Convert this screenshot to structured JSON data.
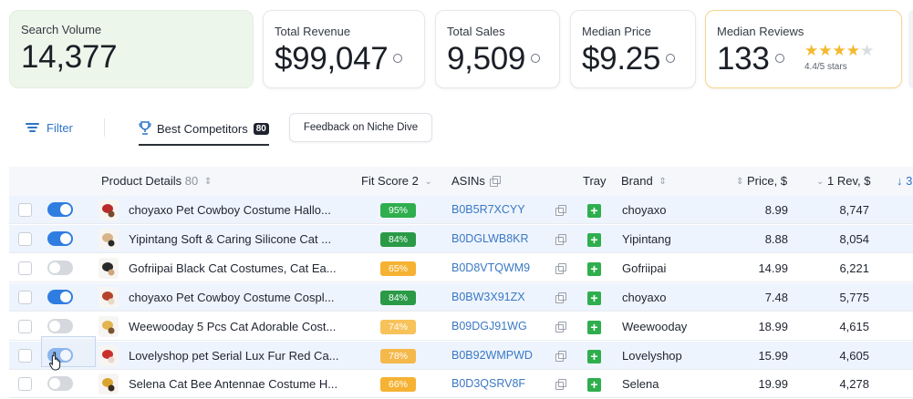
{
  "metrics": {
    "search_volume": {
      "label": "Search Volume",
      "value": "14,377"
    },
    "total_revenue": {
      "label": "Total Revenue",
      "value": "$99,047"
    },
    "total_sales": {
      "label": "Total Sales",
      "value": "9,509"
    },
    "median_price": {
      "label": "Median Price",
      "value": "$9.25"
    },
    "median_reviews": {
      "label": "Median Reviews",
      "value": "133",
      "rating_note": "4.4/5 stars",
      "rating": 4.4,
      "stars_max": 5
    }
  },
  "toolbar": {
    "filter_label": "Filter",
    "best_competitors_label": "Best Competitors",
    "best_competitors_count": "80",
    "feedback_label": "Feedback on Niche Dive"
  },
  "table": {
    "columns": {
      "product_details": "Product Details",
      "product_count": "80",
      "fit_score": "Fit Score",
      "fit_score_num": "2",
      "asins": "ASINs",
      "tray": "Tray",
      "brand": "Brand",
      "price": "Price, $",
      "rev_num": "1",
      "rev": "Rev, $",
      "next_col": "3"
    },
    "rows": [
      {
        "toggle": true,
        "product": "choyaxo Pet Cowboy Costume Hallo...",
        "fit": "95%",
        "fit_color": "#2fae4e",
        "asin": "B0B5R7XCYY",
        "brand": "choyaxo",
        "price": "8.99",
        "rev": "8,747",
        "selected": true
      },
      {
        "toggle": true,
        "product": "Yipintang Soft & Caring Silicone Cat ...",
        "fit": "84%",
        "fit_color": "#2a9a47",
        "asin": "B0DGLWB8KR",
        "brand": "Yipintang",
        "price": "8.88",
        "rev": "8,054",
        "selected": true
      },
      {
        "toggle": false,
        "product": "Gofriipai Black Cat Costumes, Cat Ea...",
        "fit": "65%",
        "fit_color": "#f6b233",
        "asin": "B0D8VTQWM9",
        "brand": "Gofriipai",
        "price": "14.99",
        "rev": "6,221",
        "selected": false
      },
      {
        "toggle": true,
        "product": "choyaxo Pet Cowboy Costume Cospl...",
        "fit": "84%",
        "fit_color": "#2a9a47",
        "asin": "B0BW3X91ZX",
        "brand": "choyaxo",
        "price": "7.48",
        "rev": "5,775",
        "selected": true
      },
      {
        "toggle": false,
        "product": "Weewooday 5 Pcs Cat Adorable Cost...",
        "fit": "74%",
        "fit_color": "#f7c25a",
        "asin": "B09DGJ91WG",
        "brand": "Weewooday",
        "price": "18.99",
        "rev": "4,615",
        "selected": false
      },
      {
        "toggle": true,
        "product": "Lovelyshop pet Serial Lux Fur Red Ca...",
        "fit": "78%",
        "fit_color": "#f5b84a",
        "asin": "B0B92WMPWD",
        "brand": "Lovelyshop",
        "price": "15.99",
        "rev": "4,605",
        "selected": true
      },
      {
        "toggle": false,
        "product": "Selena Cat Bee Antennae Costume H...",
        "fit": "66%",
        "fit_color": "#f6b233",
        "asin": "B0D3QSRV8F",
        "brand": "Selena",
        "price": "19.99",
        "rev": "4,278",
        "selected": false
      }
    ]
  }
}
